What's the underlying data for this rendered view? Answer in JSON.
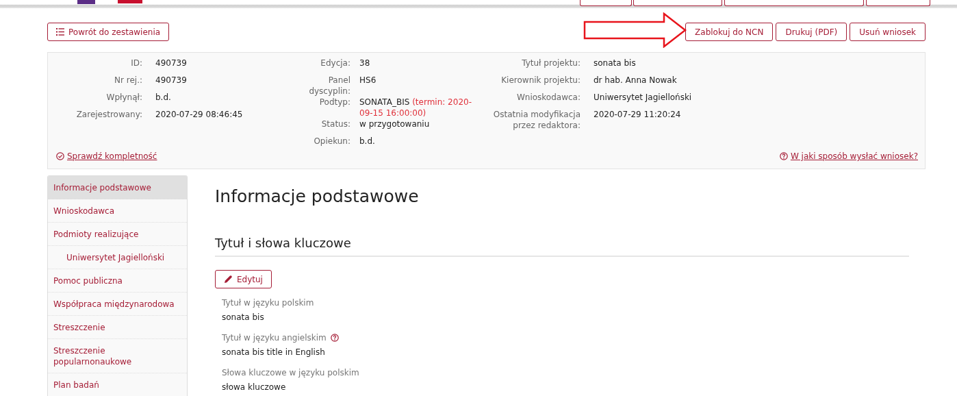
{
  "toolbar": {
    "back_button": "Powrót do zestawienia",
    "actions": [
      {
        "label": "Zablokuj do NCN"
      },
      {
        "label": "Drukuj (PDF)"
      },
      {
        "label": "Usuń wniosek"
      }
    ]
  },
  "summary": {
    "columns": [
      [
        {
          "label": "ID:",
          "value": "490739"
        },
        {
          "label": "Nr rej.:",
          "value": "490739"
        },
        {
          "label": "Wpłynął:",
          "value": "b.d."
        },
        {
          "label": "Zarejestrowany:",
          "value": "2020-07-29 08:46:45"
        }
      ],
      [
        {
          "label": "Edycja:",
          "value": "38"
        },
        {
          "label": "Panel dyscyplin:",
          "value": "HS6"
        },
        {
          "label": "Podtyp:",
          "value": "SONATA_BIS",
          "note": "(termin: 2020-09-15 16:00:00)"
        },
        {
          "label": "Status:",
          "value": "w przygotowaniu"
        },
        {
          "label": "Opiekun:",
          "value": "b.d."
        }
      ],
      [
        {
          "label": "Tytuł projektu:",
          "value": "sonata bis"
        },
        {
          "label": "Kierownik projektu:",
          "value": "dr hab. Anna Nowak"
        },
        {
          "label": "Wnioskodawca:",
          "value": "Uniwersytet Jagielloński"
        },
        {
          "label": "Ostatnia modyfikacja przez redaktora:",
          "value": "2020-07-29 11:20:24"
        }
      ]
    ],
    "check_link": "Sprawdź kompletność",
    "help_link": "W jaki sposób wysłać wniosek?"
  },
  "sidebar": {
    "items": [
      {
        "label": "Informacje podstawowe",
        "selected": true
      },
      {
        "label": "Wnioskodawca",
        "selected": false
      },
      {
        "label": "Podmioty realizujące",
        "selected": false,
        "children": [
          {
            "label": "Uniwersytet Jagielloński",
            "selected": false
          }
        ]
      },
      {
        "label": "Pomoc publiczna",
        "selected": false
      },
      {
        "label": "Współpraca międzynarodowa",
        "selected": false
      },
      {
        "label": "Streszczenie",
        "selected": false
      },
      {
        "label": "Streszczenie popularnonaukowe",
        "selected": false
      },
      {
        "label": "Plan badań",
        "selected": false
      }
    ]
  },
  "content": {
    "title": "Informacje podstawowe",
    "section_title": "Tytuł i słowa kluczowe",
    "edit_button": "Edytuj",
    "fields": [
      {
        "label": "Tytuł w języku polskim",
        "value": "sonata bis",
        "help": false
      },
      {
        "label": "Tytuł w języku angielskim",
        "value": "sonata bis title in English",
        "help": true
      },
      {
        "label": "Słowa kluczowe w języku polskim",
        "value": "słowa kluczowe",
        "help": false
      }
    ]
  }
}
